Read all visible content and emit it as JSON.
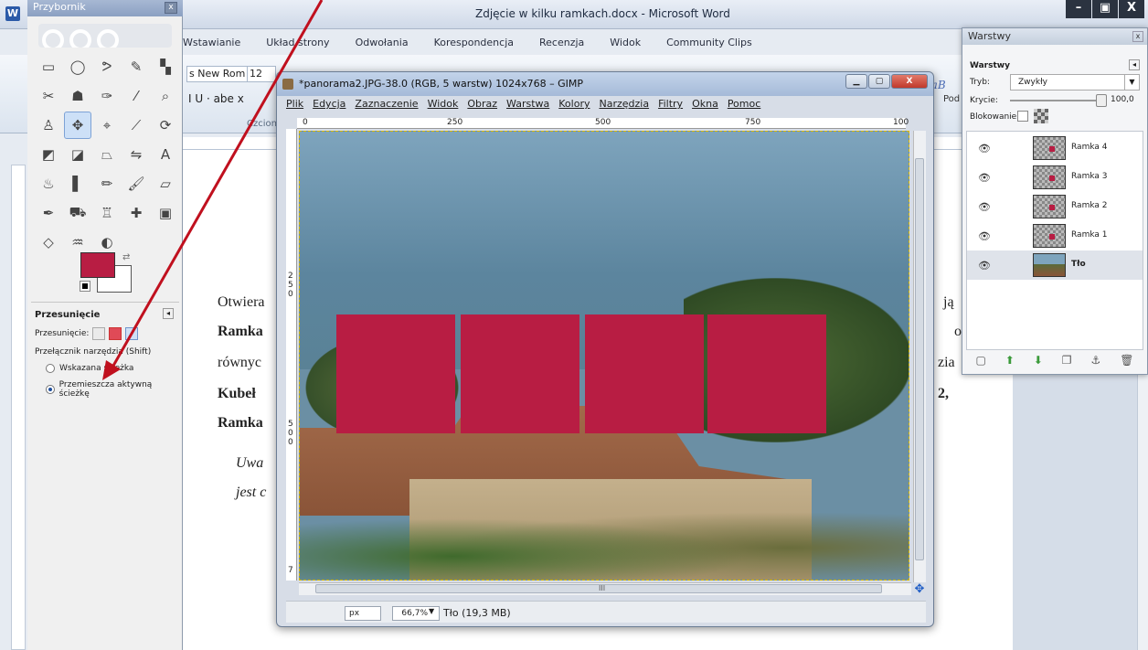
{
  "word": {
    "title": "Zdjęcie w kilku ramkach.docx - Microsoft Word",
    "logo": "W",
    "window_buttons": [
      "–",
      "▣",
      "X"
    ],
    "tabs": [
      "Wstawianie",
      "Układ strony",
      "Odwołania",
      "Korespondencja",
      "Recenzja",
      "Widok",
      "Community Clips"
    ],
    "font_name": "s New Rom",
    "font_size": "12",
    "format_row": "I  U  ·  abe  x",
    "group_label": "Czcionka",
    "styles_preview": "AaB",
    "styles_label": "Pod",
    "doc_lines": [
      {
        "text": "Otwiera",
        "bold": false,
        "italic": false
      },
      {
        "text": "Ramka",
        "bold": true,
        "italic": false
      },
      {
        "text": "równyc",
        "bold": false,
        "italic": false
      },
      {
        "text": "Kubeł",
        "bold": true,
        "italic": false
      },
      {
        "text": "Ramka",
        "bold": true,
        "italic": false
      },
      {
        "text": "Uwa",
        "bold": false,
        "italic": true
      },
      {
        "text": "jest c",
        "bold": false,
        "italic": true
      }
    ],
    "doc_right": [
      "ją",
      "o",
      "zia",
      "2,"
    ]
  },
  "toolbox": {
    "title": "Przybornik",
    "close": "x",
    "tools": [
      {
        "icon": "rect-select-icon",
        "glyph": "▭",
        "active": false
      },
      {
        "icon": "ellipse-select-icon",
        "glyph": "◯",
        "active": false
      },
      {
        "icon": "lasso-icon",
        "glyph": "ᕗ",
        "active": false
      },
      {
        "icon": "magic-wand-icon",
        "glyph": "✎",
        "active": false
      },
      {
        "icon": "color-select-icon",
        "glyph": "▚",
        "active": false
      },
      {
        "icon": "scissors-icon",
        "glyph": "✂",
        "active": false
      },
      {
        "icon": "foreground-select-icon",
        "glyph": "☗",
        "active": false
      },
      {
        "icon": "paths-icon",
        "glyph": "✑",
        "active": false
      },
      {
        "icon": "color-picker-icon",
        "glyph": "⁄",
        "active": false
      },
      {
        "icon": "zoom-icon",
        "glyph": "⌕",
        "active": false
      },
      {
        "icon": "measure-icon",
        "glyph": "♙",
        "active": false
      },
      {
        "icon": "move-icon",
        "glyph": "✥",
        "active": true
      },
      {
        "icon": "align-icon",
        "glyph": "⌖",
        "active": false
      },
      {
        "icon": "crop-icon",
        "glyph": "⟋",
        "active": false
      },
      {
        "icon": "rotate-icon",
        "glyph": "⟳",
        "active": false
      },
      {
        "icon": "scale-icon",
        "glyph": "◩",
        "active": false
      },
      {
        "icon": "shear-icon",
        "glyph": "◪",
        "active": false
      },
      {
        "icon": "perspective-icon",
        "glyph": "⏢",
        "active": false
      },
      {
        "icon": "flip-icon",
        "glyph": "⇋",
        "active": false
      },
      {
        "icon": "text-icon",
        "glyph": "A",
        "active": false
      },
      {
        "icon": "bucket-fill-icon",
        "glyph": "♨",
        "active": false
      },
      {
        "icon": "blend-icon",
        "glyph": "▌",
        "active": false
      },
      {
        "icon": "pencil-icon",
        "glyph": "✏",
        "active": false
      },
      {
        "icon": "paintbrush-icon",
        "glyph": "🖌",
        "active": false
      },
      {
        "icon": "eraser-icon",
        "glyph": "▱",
        "active": false
      },
      {
        "icon": "airbrush-icon",
        "glyph": "✒",
        "active": false
      },
      {
        "icon": "ink-icon",
        "glyph": "⛟",
        "active": false
      },
      {
        "icon": "clone-icon",
        "glyph": "♖",
        "active": false
      },
      {
        "icon": "heal-icon",
        "glyph": "✚",
        "active": false
      },
      {
        "icon": "perspective-clone-icon",
        "glyph": "▣",
        "active": false
      },
      {
        "icon": "blur-icon",
        "glyph": "◇",
        "active": false
      },
      {
        "icon": "smudge-icon",
        "glyph": "♒",
        "active": false
      },
      {
        "icon": "dodge-burn-icon",
        "glyph": "◐",
        "active": false
      }
    ],
    "fg_color": "#b81d43",
    "bg_color": "#ffffff",
    "options_title": "Przesunięcie",
    "move_label": "Przesunięcie:",
    "switch_label": "Przełącznik narzędzia (Shift)",
    "radio1": "Wskazana ścieżka",
    "radio2": "Przemieszcza aktywną ścieżkę"
  },
  "image_window": {
    "title": "*panorama2.JPG-38.0 (RGB, 5 warstw) 1024x768 – GIMP",
    "menu": [
      "Plik",
      "Edycja",
      "Zaznaczenie",
      "Widok",
      "Obraz",
      "Warstwa",
      "Kolory",
      "Narzędzia",
      "Filtry",
      "Okna",
      "Pomoc"
    ],
    "ruler_top": [
      "0",
      "250",
      "500",
      "750",
      "100"
    ],
    "ruler_left": [
      "2",
      "5",
      "0",
      "5",
      "0",
      "0",
      "7"
    ],
    "hscroll_label": "III",
    "unit": "px",
    "zoom": "66,7%",
    "layer_status": "Tło (19,3 MB)",
    "frame_color": "#b81d43"
  },
  "layers": {
    "title": "Warstwy",
    "heading": "Warstwy",
    "mode_label": "Tryb:",
    "mode_value": "Zwykły",
    "opacity_label": "Krycie:",
    "opacity_value": "100,0",
    "lock_label": "Blokowanie:",
    "items": [
      {
        "name": "Ramka 4",
        "type": "frame",
        "selected": false
      },
      {
        "name": "Ramka 3",
        "type": "frame",
        "selected": false
      },
      {
        "name": "Ramka 2",
        "type": "frame",
        "selected": false
      },
      {
        "name": "Ramka 1",
        "type": "frame",
        "selected": false
      },
      {
        "name": "Tło",
        "type": "photo",
        "selected": true
      }
    ],
    "bottom_tools": [
      "new-layer-icon",
      "raise-layer-icon",
      "lower-layer-icon",
      "duplicate-layer-icon",
      "anchor-icon",
      "delete-layer-icon"
    ]
  },
  "annotation": {
    "arrow_color": "#c0101e"
  }
}
